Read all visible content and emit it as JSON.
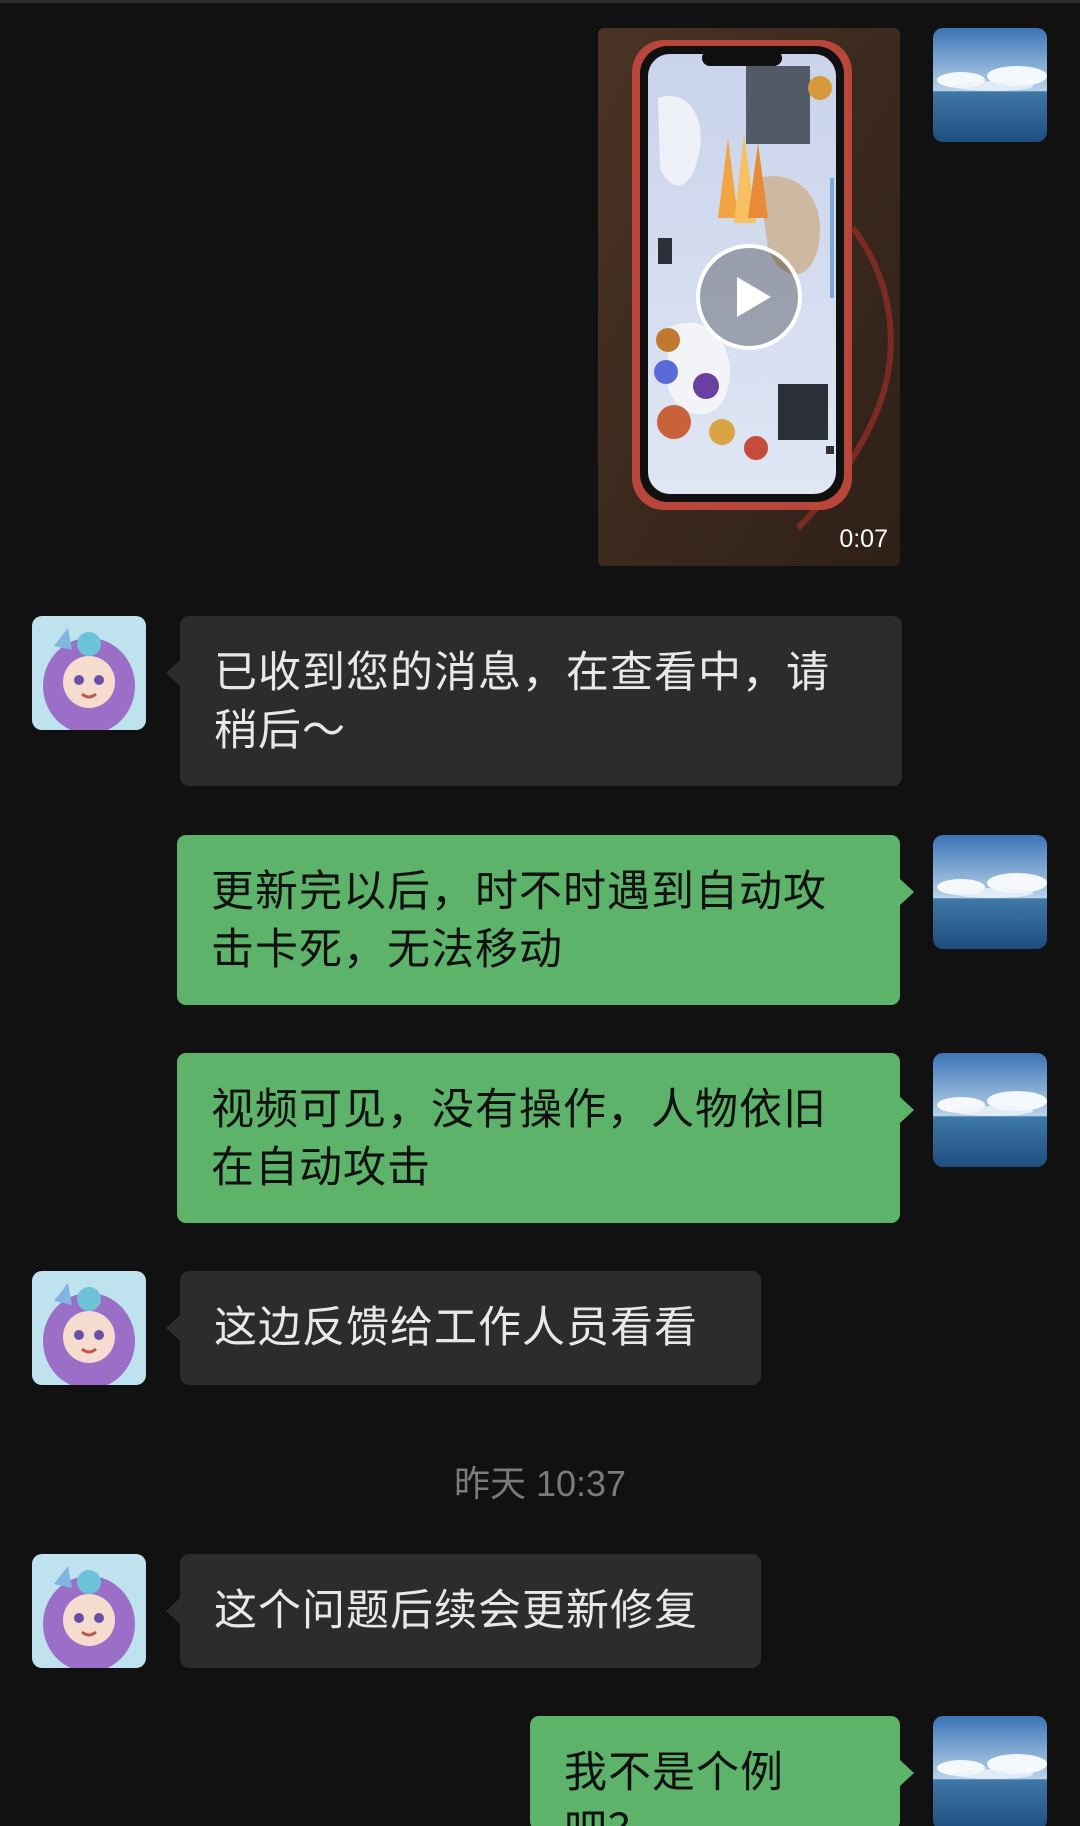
{
  "video_message": {
    "duration": "0:07"
  },
  "messages": [
    {
      "sender": "other",
      "text_line1": "已收到您的消息，在查看中，请",
      "text_line2": "稍后～"
    },
    {
      "sender": "me",
      "text_line1": "更新完以后，时不时遇到自动攻",
      "text_line2": "击卡死，无法移动"
    },
    {
      "sender": "me",
      "text_line1": "视频可见，没有操作，人物依旧",
      "text_line2": "在自动攻击"
    },
    {
      "sender": "other",
      "text": "这边反馈给工作人员看看"
    },
    {
      "sender": "other",
      "text": "这个问题后续会更新修复"
    },
    {
      "sender": "me",
      "text": "我不是个例吧？"
    }
  ],
  "timestamp": "昨天 10:37",
  "colors": {
    "background": "#111111",
    "other_bubble": "#2c2c2c",
    "my_bubble": "#5db369",
    "timestamp_text": "#7b7b7b"
  },
  "icons": {
    "my_avatar": "sky-ocean-avatar",
    "other_avatar": "anime-character-avatar",
    "play": "play-icon"
  }
}
